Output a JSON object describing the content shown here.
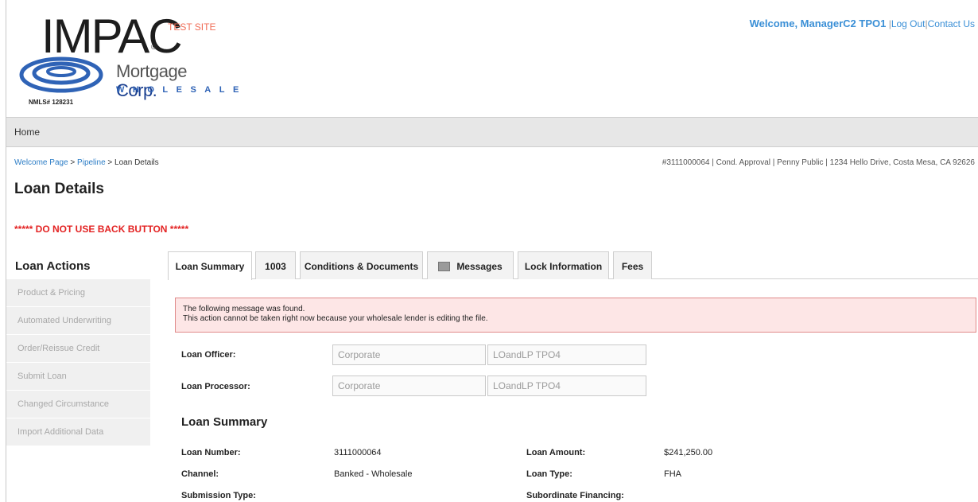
{
  "header": {
    "logo": {
      "brand": "IMPAC",
      "registered": "®",
      "line1_a": "Mortgage",
      "line1_b": "Corp.",
      "line2": "WHOLESALE",
      "nmls": "NMLS# 128231"
    },
    "test_site": "TEST SITE",
    "welcome": "Welcome, ManagerC2 TPO1",
    "logout": "Log Out",
    "contact": "Contact Us"
  },
  "nav": {
    "home": "Home"
  },
  "breadcrumb": {
    "items": [
      "Welcome Page",
      "Pipeline",
      "Loan Details"
    ],
    "separator": " > "
  },
  "loan_header_info": "#3111000064 | Cond. Approval | Penny Public | 1234 Hello Drive, Costa Mesa, CA 92626",
  "page_title": "Loan Details",
  "warning": "***** DO NOT USE BACK BUTTON *****",
  "sidebar": {
    "title": "Loan Actions",
    "items": [
      "Product & Pricing",
      "Automated Underwriting",
      "Order/Reissue Credit",
      "Submit Loan",
      "Changed Circumstance",
      "Import Additional Data"
    ]
  },
  "tabs": [
    {
      "label": "Loan Summary",
      "active": true
    },
    {
      "label": "1003",
      "active": false
    },
    {
      "label": "Conditions & Documents",
      "active": false
    },
    {
      "label": "Messages",
      "active": false,
      "icon": "envelope-icon"
    },
    {
      "label": "Lock Information",
      "active": false
    },
    {
      "label": "Fees",
      "active": false
    }
  ],
  "alert": {
    "line1": "The following message was found.",
    "line2": "This action cannot be taken right now because your wholesale lender is editing the file."
  },
  "officers": {
    "loan_officer": {
      "label": "Loan Officer:",
      "company": "Corporate",
      "name": "LOandLP TPO4"
    },
    "loan_processor": {
      "label": "Loan Processor:",
      "company": "Corporate",
      "name": "LOandLP TPO4"
    }
  },
  "summary": {
    "title": "Loan Summary",
    "rows": [
      {
        "label1": "Loan Number:",
        "value1": "3111000064",
        "label2": "Loan Amount:",
        "value2": "$241,250.00"
      },
      {
        "label1": "Channel:",
        "value1": "Banked - Wholesale",
        "label2": "Loan Type:",
        "value2": "FHA"
      },
      {
        "label1": "Submission Type:",
        "value1": "",
        "label2": "Subordinate Financing:",
        "value2": ""
      }
    ]
  },
  "colors": {
    "accent_blue": "#3a8fd6",
    "link_blue": "#2c7dc6",
    "warning_red": "#e32222",
    "test_site_orange": "#f06d57",
    "alert_bg": "#fde6e6",
    "alert_border": "#e08a8a"
  }
}
